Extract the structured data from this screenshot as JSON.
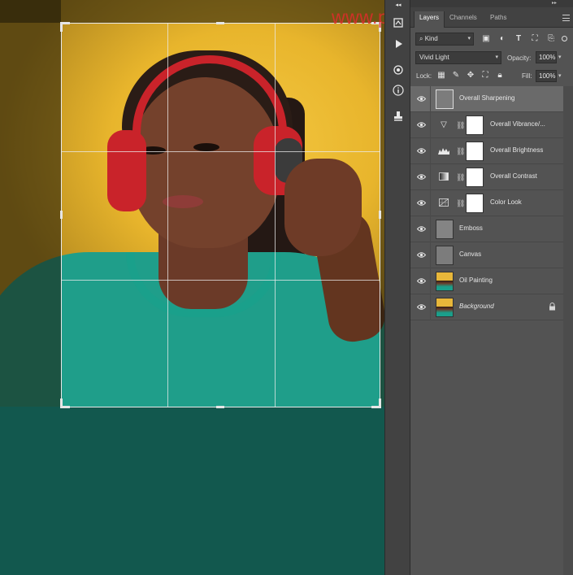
{
  "watermark": "www.psahz.com",
  "panel": {
    "tabs": [
      {
        "label": "Layers",
        "active": true
      },
      {
        "label": "Channels",
        "active": false
      },
      {
        "label": "Paths",
        "active": false
      }
    ],
    "filter": {
      "kind_label": "Kind"
    },
    "blend": {
      "mode": "Vivid Light",
      "opacity_label": "Opacity:",
      "opacity_value": "100%"
    },
    "lock": {
      "label": "Lock:",
      "fill_label": "Fill:",
      "fill_value": "100%"
    }
  },
  "layers": [
    {
      "name": "Overall Sharpening",
      "type": "pixel",
      "selected": true
    },
    {
      "name": "Overall Vibrance/...",
      "type": "adjustment",
      "icon": "vibrance-icon"
    },
    {
      "name": "Overall Brightness",
      "type": "adjustment",
      "icon": "levels-icon"
    },
    {
      "name": "Overall Contrast",
      "type": "adjustment",
      "icon": "gradient-map-icon"
    },
    {
      "name": "Color Look",
      "type": "adjustment",
      "icon": "color-lookup-icon"
    },
    {
      "name": "Emboss",
      "type": "pixel"
    },
    {
      "name": "Canvas",
      "type": "pixel"
    },
    {
      "name": "Oil Painting",
      "type": "image"
    },
    {
      "name": "Background",
      "type": "image",
      "locked": true
    }
  ],
  "colors": {
    "panel_bg": "#535353",
    "selected_layer": "#6a6a6a",
    "watermark": "#e02c2c",
    "shirt": "#1f9e8a",
    "backdrop": "#f4c842",
    "headphones": "#c9232a"
  }
}
